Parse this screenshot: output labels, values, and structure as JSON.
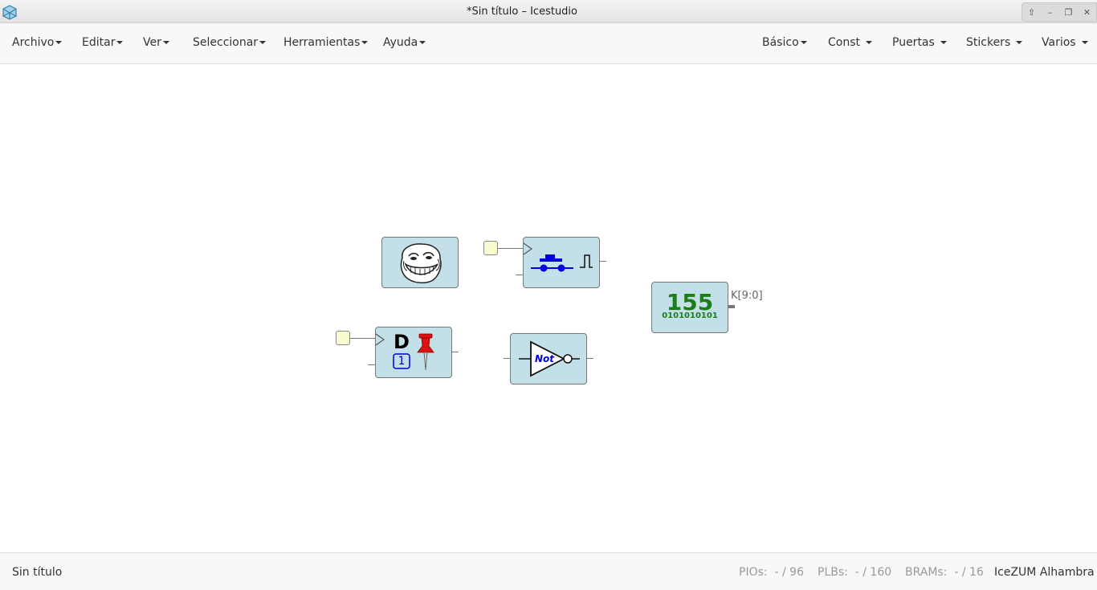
{
  "window": {
    "title": "*Sin título – Icestudio",
    "controls": [
      "⇧",
      "–",
      "❐",
      "✕"
    ]
  },
  "menu_left": [
    {
      "label": "Archivo"
    },
    {
      "label": "Editar"
    },
    {
      "label": "Ver"
    },
    {
      "label": "Seleccionar"
    },
    {
      "label": "Herramientas"
    },
    {
      "label": "Ayuda"
    }
  ],
  "menu_right": [
    {
      "label": "Básico"
    },
    {
      "label": "Const"
    },
    {
      "label": "Puertas"
    },
    {
      "label": "Stickers"
    },
    {
      "label": "Varios"
    }
  ],
  "canvas": {
    "constant_block": {
      "value": "155",
      "binary": "0101010101",
      "output_port": "K[9:0]"
    },
    "not_gate_label": "Not",
    "dff_label": "D",
    "dff_init": "1"
  },
  "status": {
    "file_name": "Sin título",
    "pios_label": "PIOs:",
    "pios_value": "- / 96",
    "plbs_label": "PLBs:",
    "plbs_value": "- / 160",
    "brams_label": "BRAMs:",
    "brams_value": "- / 16",
    "board": "IceZUM Alhambra"
  },
  "colors": {
    "block_fill": "#c3dfe8",
    "const_green": "#1a7f1a",
    "button_blue": "#0000dd",
    "pin_red": "#dd1111"
  }
}
